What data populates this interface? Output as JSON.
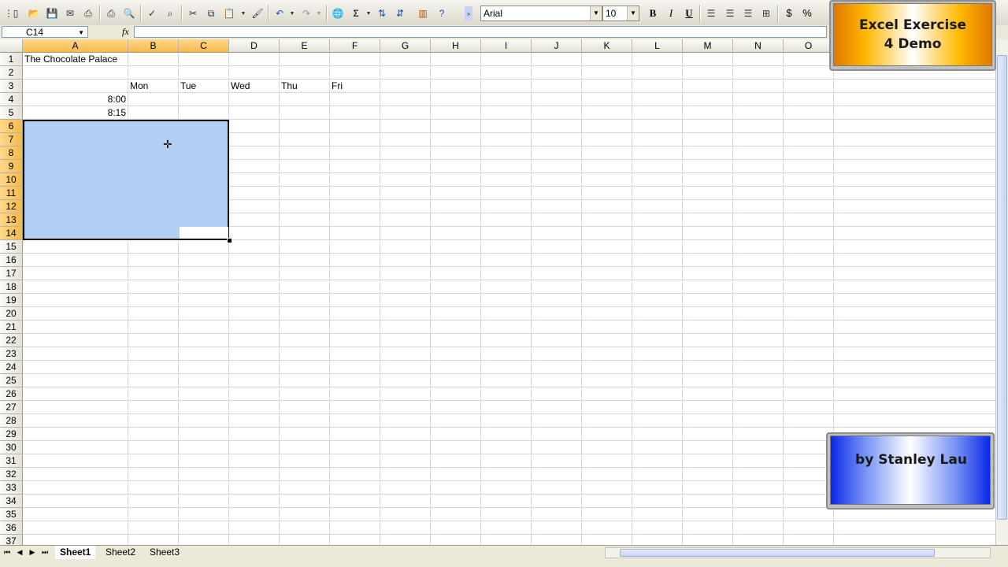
{
  "toolbar": {
    "font_name": "Arial",
    "font_size": "10",
    "bold_label": "B",
    "italic_label": "I",
    "underline_label": "U",
    "currency_label": "$",
    "percent_label": "%"
  },
  "formula_bar": {
    "name_box": "C14",
    "fx_label": "fx",
    "formula": ""
  },
  "columns": [
    "A",
    "B",
    "C",
    "D",
    "E",
    "F",
    "G",
    "H",
    "I",
    "J",
    "K",
    "L",
    "M",
    "N",
    "O"
  ],
  "rows": [
    "1",
    "2",
    "3",
    "4",
    "5",
    "6",
    "7",
    "8",
    "9",
    "10",
    "11",
    "12",
    "13",
    "14",
    "15",
    "16",
    "17",
    "18",
    "19",
    "20",
    "21",
    "22",
    "23",
    "24",
    "25",
    "26",
    "27",
    "28",
    "29",
    "30",
    "31",
    "32",
    "33",
    "34",
    "35",
    "36",
    "37"
  ],
  "cells": {
    "A1": "The Chocolate Palace",
    "B3": "Mon",
    "C3": "Tue",
    "D3": "Wed",
    "E3": "Thu",
    "F3": "Fri",
    "A4": "8:00",
    "A5": "8:15"
  },
  "sheets": [
    "Sheet1",
    "Sheet2",
    "Sheet3"
  ],
  "overlay": {
    "title": "Excel Exercise 4 Demo",
    "author": "by Stanley Lau"
  },
  "colors": {
    "selection": "#b3cff1",
    "header_selected": "#f5b94a"
  }
}
